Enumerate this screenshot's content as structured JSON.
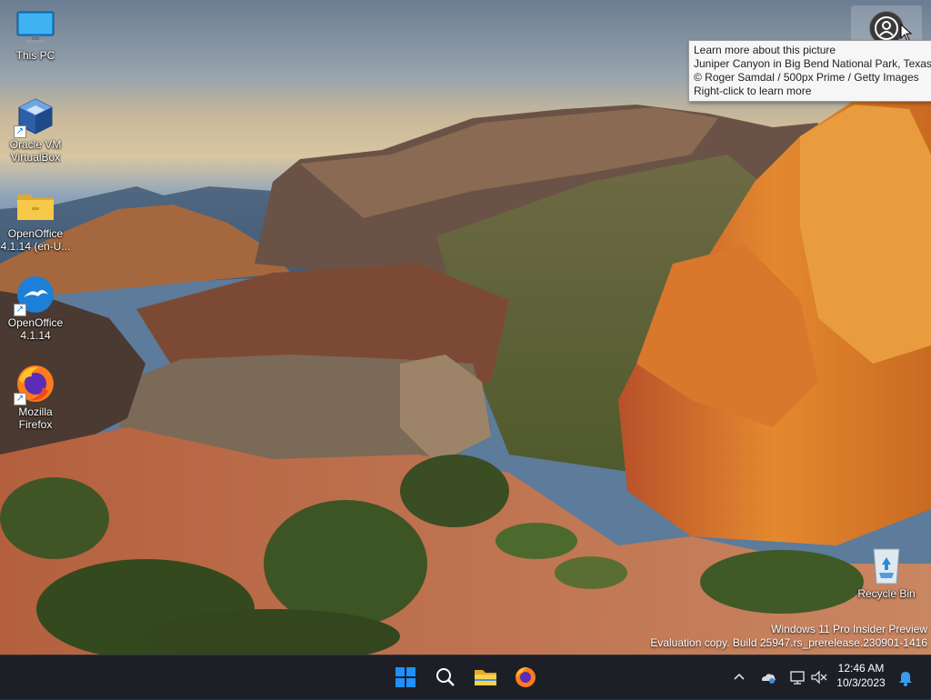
{
  "desktop": {
    "icons": [
      {
        "label": "This PC",
        "icon": "monitor-icon"
      },
      {
        "label": "Oracle VM\nVirtualBox",
        "icon": "virtualbox-icon"
      },
      {
        "label": "OpenOffice\n4.1.14 (en-U...",
        "icon": "folder-icon"
      },
      {
        "label": "OpenOffice\n4.1.14",
        "icon": "openoffice-icon"
      },
      {
        "label": "Mozilla\nFirefox",
        "icon": "firefox-icon"
      },
      {
        "label": "Recycle Bin",
        "icon": "recycle-bin-icon"
      }
    ]
  },
  "spotlight": {
    "icon": "learn-about-picture-icon",
    "tooltip": {
      "line1": "Learn more about this picture",
      "line2": "Juniper Canyon in Big Bend National Park, Texas",
      "line3": "© Roger Samdal / 500px Prime / Getty Images",
      "line4": "Right-click to learn more"
    }
  },
  "watermark": {
    "line1": "Windows 11 Pro Insider Preview",
    "line2": "Evaluation copy. Build 25947.rs_prerelease.230901-1416"
  },
  "taskbar": {
    "pinned": [
      "start-icon",
      "search-icon",
      "file-explorer-icon",
      "firefox-icon"
    ],
    "tray": [
      "chevron-up-icon",
      "onedrive-icon",
      "network-icon",
      "volume-muted-icon"
    ],
    "time": "12:46 AM",
    "date": "10/3/2023",
    "notifications_icon": "bell-icon"
  },
  "colors": {
    "taskbar_bg": "#1c2026",
    "start_blue": "#1e90ff",
    "tooltip_bg": "#f6f6f6"
  }
}
